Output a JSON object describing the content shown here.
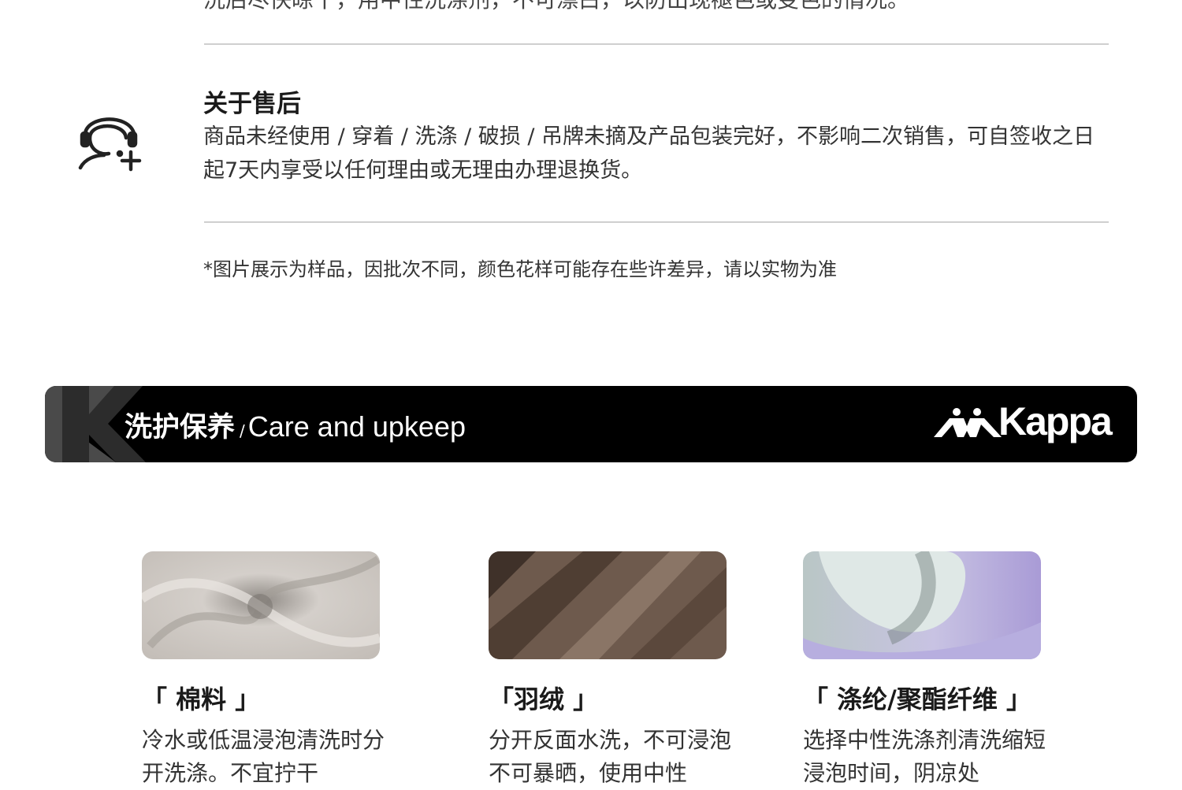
{
  "top_clip_text": "洗后尽快晾干，用中性洗涤剂，不可漂白，以防出现褪色或变色的情况。",
  "after_sale": {
    "title": "关于售后",
    "text": "商品未经使用 / 穿着 / 洗涤 / 破损 / 吊牌未摘及产品包装完好，不影响二次销售，可自签收之日起7天内享受以任何理由或无理由办理退换货。",
    "icon": "customer-service-icon"
  },
  "disclaimer": "*图片展示为样品，因批次不同，颜色花样可能存在些许差异，请以实物为准",
  "banner": {
    "title_zh": "洗护保养",
    "separator": "/",
    "title_en": "Care and upkeep",
    "brand": "Kappa"
  },
  "fabrics": [
    {
      "name": "「 棉料 」",
      "desc": "冷水或低温浸泡清洗时分开洗涤。不宜拧干"
    },
    {
      "name": "「羽绒 」",
      "desc": "分开反面水洗，不可浸泡不可暴晒，使用中性"
    },
    {
      "name": "「 涤纶/聚酯纤维 」",
      "desc": "选择中性洗涤剂清洗缩短浸泡时间，阴凉处"
    }
  ],
  "colors": {
    "banner_bg": "#000000",
    "banner_text": "#ffffff",
    "divider": "#cfcfcf"
  }
}
